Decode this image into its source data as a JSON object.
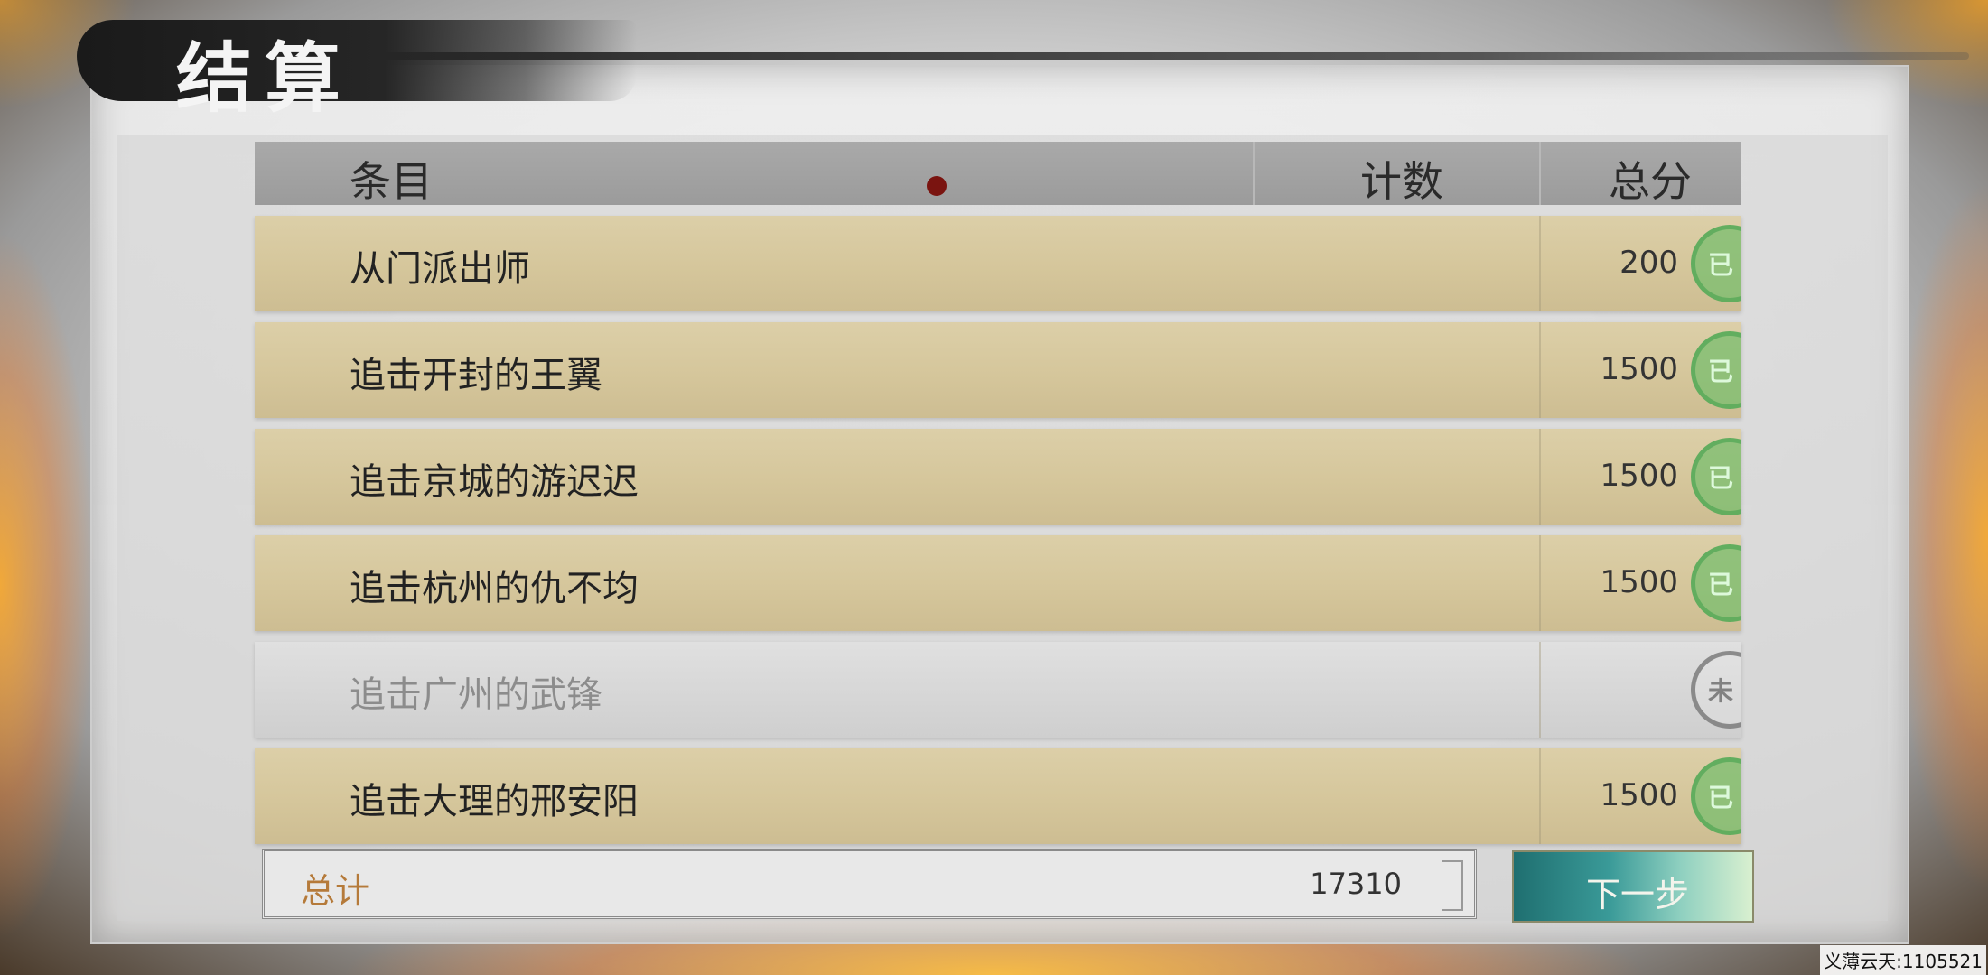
{
  "header": {
    "title": "结算"
  },
  "table": {
    "columns": {
      "item": "条目",
      "count": "计数",
      "total": "总分"
    },
    "rows": [
      {
        "label": "从门派出师",
        "score": "200",
        "status": "已完成"
      },
      {
        "label": "追击开封的王翼",
        "score": "1500",
        "status": "已完成"
      },
      {
        "label": "追击京城的游迟迟",
        "score": "1500",
        "status": "已完成"
      },
      {
        "label": "追击杭州的仇不均",
        "score": "1500",
        "status": "已完成"
      },
      {
        "label": "追击广州的武锋",
        "score": "",
        "status": "未完成"
      },
      {
        "label": "追击大理的邢安阳",
        "score": "1500",
        "status": "已完成"
      }
    ]
  },
  "footer": {
    "total_label": "总计",
    "total_value": "17310",
    "next_button": "下一步"
  },
  "watermark": "义薄云天:1105521",
  "colors": {
    "row_completed": "#d5c69b",
    "stamp_completed": "#6fb86a",
    "next_button": "#3a9a98",
    "total_label": "#b57a3a"
  }
}
